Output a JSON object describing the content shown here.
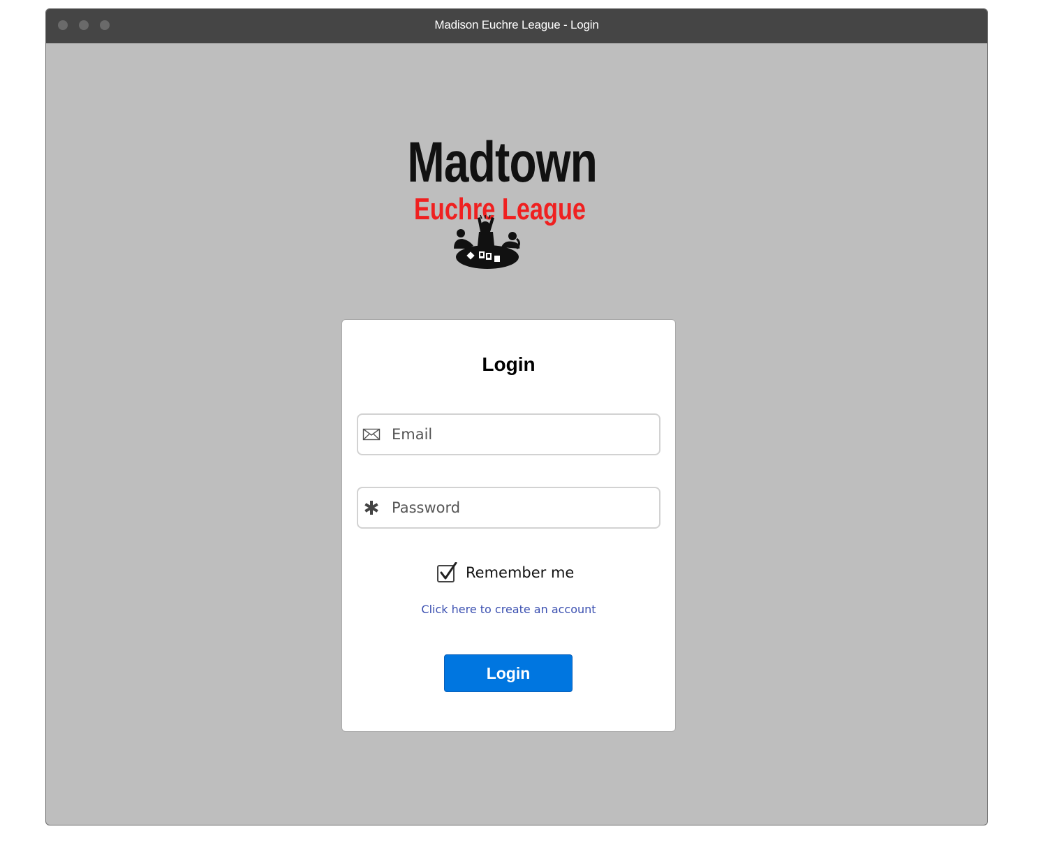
{
  "window": {
    "title": "Madison Euchre League - Login"
  },
  "logo": {
    "line1": "Madtown",
    "line2": "Euchre League",
    "line1_color": "#111111",
    "line2_color": "#ef2020"
  },
  "login_card": {
    "title": "Login",
    "email": {
      "icon": "envelope-icon",
      "placeholder": "Email",
      "value": ""
    },
    "password": {
      "icon": "asterisk-icon",
      "placeholder": "Password",
      "value": ""
    },
    "remember_me": {
      "label": "Remember me",
      "checked": true
    },
    "create_account_link": "Click here to create an account",
    "login_button": "Login"
  },
  "colors": {
    "background": "#bebebe",
    "titlebar": "#454545",
    "button": "#0076e0",
    "link": "#3a4fb0"
  }
}
